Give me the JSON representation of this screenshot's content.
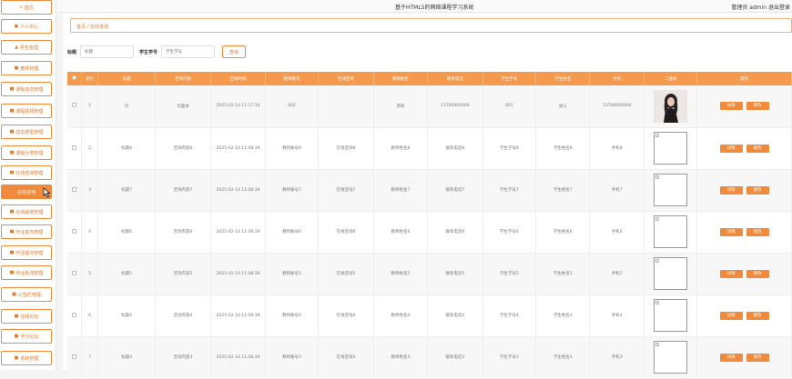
{
  "app": {
    "title": "基于HTML5的网络课程学习系统",
    "user_text": "管理员 admin  退出登录"
  },
  "sidebar": {
    "items": [
      {
        "label": "首页",
        "icon": "home-icon",
        "glyph": "⌂",
        "active": false
      },
      {
        "label": "个人中心",
        "icon": "user-icon",
        "glyph": "●",
        "active": false
      },
      {
        "label": "学生管理",
        "icon": "users-icon",
        "glyph": "▲",
        "active": false
      },
      {
        "label": "教师管理",
        "icon": "grid-icon",
        "glyph": "■",
        "active": false
      },
      {
        "label": "课程信息管理",
        "icon": "grid-icon",
        "glyph": "■",
        "active": false
      },
      {
        "label": "课程视频管理",
        "icon": "grid-icon",
        "glyph": "■",
        "active": false
      },
      {
        "label": "信息类型管理",
        "icon": "grid-icon",
        "glyph": "■",
        "active": false
      },
      {
        "label": "课程分类管理",
        "icon": "grid-icon",
        "glyph": "■",
        "active": false
      },
      {
        "label": "在线咨询管理",
        "icon": "chat-icon",
        "glyph": "■",
        "active": false
      },
      {
        "label": "在线咨询",
        "icon": "none",
        "glyph": "",
        "active": true
      },
      {
        "label": "在线解答管理",
        "icon": "grid-icon",
        "glyph": "■",
        "active": false
      },
      {
        "label": "作业发布管理",
        "icon": "grid-icon",
        "glyph": "■",
        "active": false
      },
      {
        "label": "作业提交管理",
        "icon": "chat-icon",
        "glyph": "■",
        "active": false
      },
      {
        "label": "作业批改管理",
        "icon": "grid-icon",
        "glyph": "■",
        "active": false
      },
      {
        "label": "公告栏管理",
        "icon": "grid-icon",
        "glyph": "■",
        "active": false
      },
      {
        "label": "在线论坛",
        "icon": "grid-icon",
        "glyph": "■",
        "active": false
      },
      {
        "label": "学习论坛",
        "icon": "grid-icon",
        "glyph": "■",
        "active": false
      },
      {
        "label": "系统管理",
        "icon": "grid-icon",
        "glyph": "■",
        "active": false
      }
    ]
  },
  "breadcrumb": "首页 / 在线咨询",
  "search": {
    "title_label": "标题",
    "title_placeholder": "标题",
    "student_label": "学生学号",
    "student_placeholder": "学生学号",
    "button": "查询"
  },
  "table": {
    "headers": [
      "",
      "索引",
      "标题",
      "咨询内容",
      "咨询时间",
      "教师账号",
      "在线咨询",
      "教师姓名",
      "联系电话",
      "学生学号",
      "学生姓名",
      "手机",
      "二维码",
      "操作"
    ],
    "detail_label": "详情",
    "edit_label": "修改",
    "rows": [
      {
        "index": "1",
        "title": "页",
        "content": "页面本",
        "time": "2025-02-14 11:17:34",
        "teacher_no": "002",
        "consult": "",
        "teacher_name": "李四",
        "phone": "13700000000",
        "student_no": "001",
        "student_name": "张三",
        "mobile": "13700000000",
        "qr": "photo"
      },
      {
        "index": "2",
        "title": "标题8",
        "content": "咨询内容8",
        "time": "2025-02-14 11:08:39",
        "teacher_no": "教师账号8",
        "consult": "在线咨询8",
        "teacher_name": "教师姓名8",
        "phone": "联系电话8",
        "student_no": "学生学号8",
        "student_name": "学生姓名8",
        "mobile": "手机8",
        "qr": "broken"
      },
      {
        "index": "3",
        "title": "标题7",
        "content": "咨询内容7",
        "time": "2025-02-14 11:08:39",
        "teacher_no": "教师账号7",
        "consult": "在线咨询7",
        "teacher_name": "教师姓名7",
        "phone": "联系电话7",
        "student_no": "学生学号7",
        "student_name": "学生姓名7",
        "mobile": "手机7",
        "qr": "broken"
      },
      {
        "index": "4",
        "title": "标题6",
        "content": "咨询内容6",
        "time": "2025-02-14 11:08:39",
        "teacher_no": "教师账号6",
        "consult": "在线咨询6",
        "teacher_name": "教师姓名6",
        "phone": "联系电话6",
        "student_no": "学生学号6",
        "student_name": "学生姓名6",
        "mobile": "手机6",
        "qr": "broken"
      },
      {
        "index": "5",
        "title": "标题5",
        "content": "咨询内容5",
        "time": "2025-02-14 11:08:39",
        "teacher_no": "教师账号5",
        "consult": "在线咨询5",
        "teacher_name": "教师姓名5",
        "phone": "联系电话5",
        "student_no": "学生学号5",
        "student_name": "学生姓名5",
        "mobile": "手机5",
        "qr": "broken"
      },
      {
        "index": "6",
        "title": "标题4",
        "content": "咨询内容4",
        "time": "2025-02-14 11:08:39",
        "teacher_no": "教师账号4",
        "consult": "在线咨询4",
        "teacher_name": "教师姓名4",
        "phone": "联系电话4",
        "student_no": "学生学号4",
        "student_name": "学生姓名4",
        "mobile": "手机4",
        "qr": "broken"
      },
      {
        "index": "7",
        "title": "标题3",
        "content": "咨询内容3",
        "time": "2025-02-14 11:08:39",
        "teacher_no": "教师账号3",
        "consult": "在线咨询3",
        "teacher_name": "教师姓名3",
        "phone": "联系电话3",
        "student_no": "学生学号3",
        "student_name": "学生姓名3",
        "mobile": "手机3",
        "qr": "broken"
      }
    ]
  },
  "colors": {
    "accent": "#f08a3c",
    "header_bg": "#f59a4d"
  }
}
